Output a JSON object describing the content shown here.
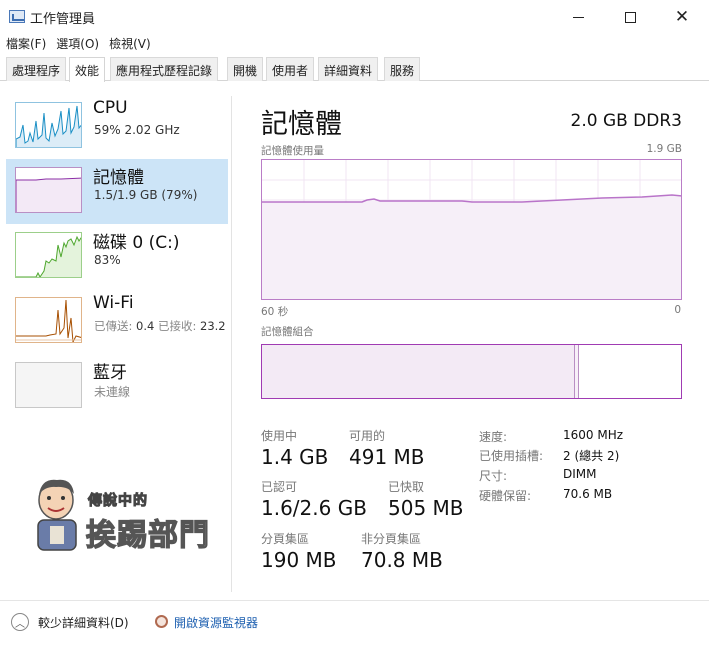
{
  "window": {
    "title": "工作管理員"
  },
  "menu": [
    "檔案(F)",
    "選項(O)",
    "檢視(V)"
  ],
  "tabs": [
    {
      "label": "處理程序",
      "active": false
    },
    {
      "label": "效能",
      "active": true
    },
    {
      "label": "應用程式歷程記錄",
      "active": false
    },
    {
      "label": "開機",
      "active": false
    },
    {
      "label": "使用者",
      "active": false
    },
    {
      "label": "詳細資料",
      "active": false
    },
    {
      "label": "服務",
      "active": false
    }
  ],
  "sidebar": {
    "items": [
      {
        "name": "CPU",
        "sub": "59%  2.02 GHz",
        "color": "#1a8fc5",
        "selected": false
      },
      {
        "name": "記憶體",
        "sub": "1.5/1.9 GB (79%)",
        "color": "#8b2ea6",
        "selected": true
      },
      {
        "name": "磁碟 0 (C:)",
        "sub": "83%",
        "color": "#4ea72e",
        "selected": false
      },
      {
        "name": "Wi-Fi",
        "sub_label1": "已傳送:",
        "sub_value1": "0.4",
        "sub_label2": "已接收:",
        "sub_value2": "23.2",
        "color": "#a74f01",
        "selected": false
      },
      {
        "name": "藍牙",
        "sub": "未連線",
        "selected": false
      }
    ]
  },
  "memory": {
    "title": "記憶體",
    "spec": "2.0 GB DDR3",
    "usage_label": "記憶體使用量",
    "usage_max": "1.9 GB",
    "time_left": "60 秒",
    "time_right": "0",
    "composition_label": "記憶體組合",
    "stats": {
      "in_use_label": "使用中",
      "in_use": "1.4 GB",
      "available_label": "可用的",
      "available": "491 MB",
      "committed_label": "已認可",
      "committed": "1.6/2.6 GB",
      "cached_label": "已快取",
      "cached": "505 MB",
      "paged_label": "分頁集區",
      "paged": "190 MB",
      "nonpaged_label": "非分頁集區",
      "nonpaged": "70.8 MB"
    },
    "details": [
      {
        "label": "速度:",
        "value": "1600 MHz"
      },
      {
        "label": "已使用插槽:",
        "value": "2 (總共 2)"
      },
      {
        "label": "尺寸:",
        "value": "DIMM"
      },
      {
        "label": "硬體保留:",
        "value": "70.6 MB"
      }
    ]
  },
  "watermark": {
    "line1": "傳說中的",
    "line2": "挨踢部門"
  },
  "footer": {
    "fewer_details": "較少詳細資料(D)",
    "resource_monitor": "開啟資源監視器"
  },
  "colors": {
    "memory_accent": "#8b2ea6",
    "graph_border": "#ba7dc7",
    "selected_bg": "#cce4f7",
    "link": "#1c5fb0"
  }
}
